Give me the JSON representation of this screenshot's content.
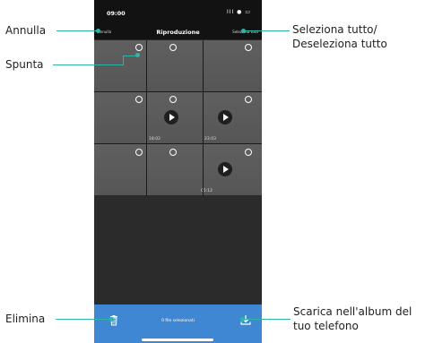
{
  "statusbar": {
    "time": "09:00",
    "icons_text": "ІІІ ● ▭"
  },
  "topbar": {
    "cancel": "Annulla",
    "title": "Riproduzione",
    "select_all": "Seleziona tutti"
  },
  "durations": [
    "18:02",
    "23:03",
    "05:12"
  ],
  "bottombar": {
    "status": "0 file selezionati"
  },
  "callouts": {
    "annulla": "Annulla",
    "spunta": "Spunta",
    "seleziona_line1": "Seleziona tutto/",
    "seleziona_line2": "Deseleziona tutto",
    "elimina": "Elimina",
    "scarica_line1": "Scarica nell'album del",
    "scarica_line2": "tuo telefono"
  },
  "colors": {
    "accent": "#2fb5a6",
    "bottombar": "#3f87d3",
    "background": "#2b2b2b"
  },
  "icons": [
    "trash-icon",
    "download-icon",
    "play-icon",
    "select-circle-icon",
    "signal-icon",
    "wifi-icon",
    "battery-icon"
  ]
}
